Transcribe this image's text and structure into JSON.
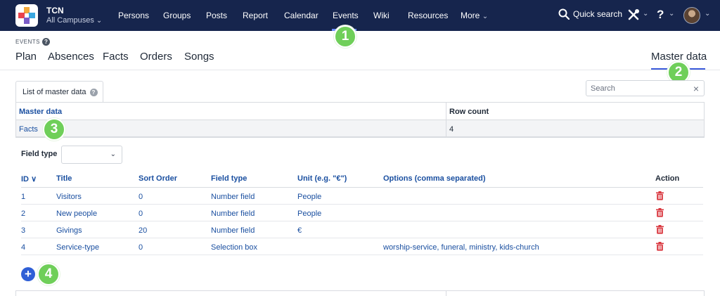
{
  "brand": {
    "name": "TCN",
    "campus": "All Campuses"
  },
  "nav": [
    "Persons",
    "Groups",
    "Posts",
    "Report",
    "Calendar",
    "Events",
    "Wiki",
    "Resources",
    "More"
  ],
  "topbar": {
    "search_label": "Quick search",
    "help_label": "?"
  },
  "badges": [
    "1",
    "2",
    "3",
    "4"
  ],
  "section": {
    "label": "EVENTS",
    "help": "?"
  },
  "tabs": [
    "Plan",
    "Absences",
    "Facts",
    "Orders",
    "Songs"
  ],
  "tab_right": "Master data",
  "card_tab": {
    "label": "List of master data",
    "info": "?"
  },
  "search": {
    "placeholder": "Search",
    "clear": "×"
  },
  "master_table": {
    "headers": [
      "Master data",
      "Row count"
    ],
    "rows": [
      {
        "name": "Facts",
        "count": "4"
      }
    ]
  },
  "filter": {
    "label": "Field type",
    "value": ""
  },
  "detail_table": {
    "headers": [
      "ID",
      "Title",
      "Sort Order",
      "Field type",
      "Unit (e.g. \"€\")",
      "Options (comma separated)",
      "Action"
    ],
    "sort_indicator": "∨",
    "rows": [
      {
        "id": "1",
        "title": "Visitors",
        "sort": "0",
        "type": "Number field",
        "unit": "People",
        "options": ""
      },
      {
        "id": "2",
        "title": "New people",
        "sort": "0",
        "type": "Number field",
        "unit": "People",
        "options": ""
      },
      {
        "id": "3",
        "title": "Givings",
        "sort": "20",
        "type": "Number field",
        "unit": "€",
        "options": ""
      },
      {
        "id": "4",
        "title": "Service-type",
        "sort": "0",
        "type": "Selection box",
        "unit": "",
        "options": "worship-service, funeral, ministry, kids-church"
      }
    ]
  },
  "add_button": "+",
  "colors": {
    "navbar": "#16254d",
    "link": "#1a4fa0",
    "accent": "#2f5fd6",
    "badge": "#6fcf59",
    "delete": "#d9363e"
  }
}
